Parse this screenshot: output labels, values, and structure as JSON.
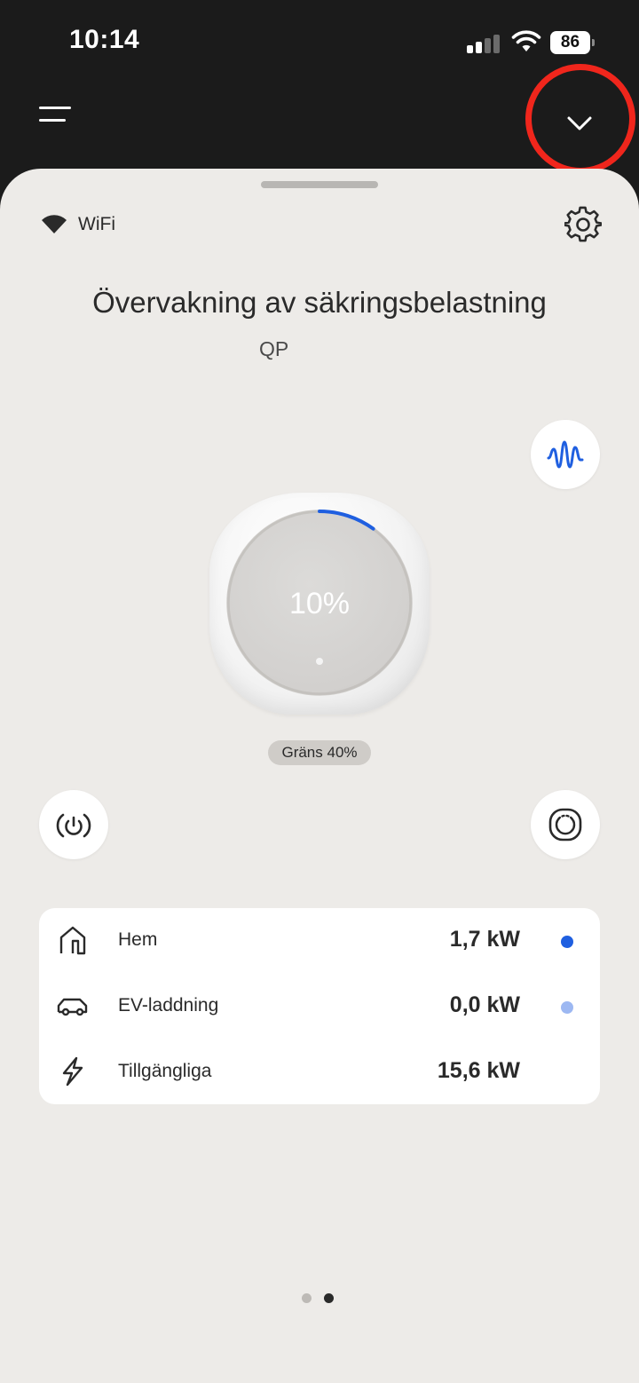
{
  "status_bar": {
    "time": "10:14",
    "battery": "86"
  },
  "header": {
    "menu_icon": "hamburger-menu-icon",
    "collapse_icon": "chevron-down-icon",
    "highlight_color": "#f0261c"
  },
  "connection": {
    "label": "WiFi",
    "icon": "wifi-icon"
  },
  "settings_icon": "gear-icon",
  "title": "Övervakning av säkringsbelastning",
  "subtitle": "QP",
  "device": {
    "load_percent": "10%",
    "load_fraction": 0.1,
    "accent_color": "#1f5fe0"
  },
  "limit_badge": "Gräns 40%",
  "action_buttons": {
    "waveform_icon": "waveform-icon",
    "power_icon": "power-signal-icon",
    "device_icon": "device-ring-icon"
  },
  "power_rows": [
    {
      "icon": "home-icon",
      "label": "Hem",
      "value": "1,7 kW",
      "dot_color": "#1f5fe0"
    },
    {
      "icon": "car-icon",
      "label": "EV-laddning",
      "value": "0,0 kW",
      "dot_color": "#9db8f2"
    },
    {
      "icon": "lightning-icon",
      "label": "Tillgängliga",
      "value": "15,6 kW",
      "dot_color": null
    }
  ],
  "pager": {
    "total": 2,
    "active_index": 1
  }
}
